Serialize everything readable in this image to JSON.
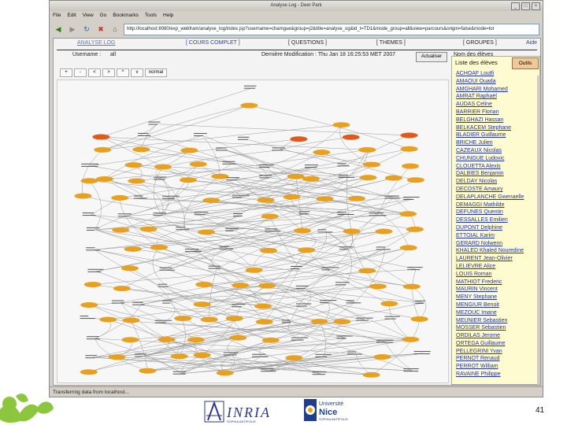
{
  "window": {
    "title": "Analyse Log - Deer Park"
  },
  "menu": [
    "File",
    "Edit",
    "View",
    "Go",
    "Bookmarks",
    "Tools",
    "Help"
  ],
  "url": "http://localhost:8080/exp_webfram/analyse_log/index.jsp?username=chamgue&group=j2&title=analyse_og&id_t=TD1&mode_group=all&view=parcours&origin=false&mode=tor",
  "tabs": {
    "analyse_log": "ANALYSE LOG",
    "cours_complet": "[ COURS COMPLET ]",
    "questions": "[ QUESTIONS ]",
    "themes": "[ THEMES ]",
    "groupes": "[ GROUPES ]",
    "aide": "Aide"
  },
  "info": {
    "username_label": "Username :",
    "username_value": "all",
    "modif": "Dernière Modification : Thu Jan 18 16:25:53 MET 2007",
    "refresh": "Actualiser",
    "students_header": "Nom des élèves"
  },
  "zoom": [
    "+",
    "-",
    "<",
    ">",
    "^",
    "v",
    "normal"
  ],
  "students": {
    "title": "Liste des élèves",
    "tools": "Outils",
    "names": [
      "ACHOAF Loutfi",
      "AMAOUI Ouada",
      "AMGHARI Mohamed",
      "AMRAT Raphaël",
      "AUDAS Celine",
      "BARRIER Florian",
      "BELGHAZI Hassan",
      "BELKACEM Stephane",
      "BLADIER Guillaume",
      "BRICHE Julien",
      "CAZEAUX Nicolas",
      "CHUNGUE Ludovic",
      "CLOUETTA Alexis",
      "DALBIES Benjamin",
      "DELDAY Nicolas",
      "DECOSTE Amaury",
      "DELAPLANCHE Gwenaelle",
      "DEMAGGI Mathilde",
      "DEFUNES Quentin",
      "DESSALLES Emilien",
      "DUPONT Delphine",
      "ETTOIAL Karim",
      "GERARD Nolwenn",
      "KHALED Khaled Nouredine",
      "LAURENT Jean-Olivier",
      "LELIEVRE Alice",
      "LOUIS Roman",
      "MATHIOT Frederic",
      "MAURIN Vincent",
      "MENY Stephane",
      "MENGIUR Benoit",
      "MEZOUC Imane",
      "MEUNIER Sebastien",
      "MOSSER Sebastien",
      "ORDILAS Jerome",
      "ORTEGA Guillaume",
      "PELLEGRINI Yvan",
      "PERNOT Renaud",
      "PERROT William",
      "RAVAINE Philippe"
    ]
  },
  "status": "Transferring data from localhost...",
  "footer": {
    "page_number": "41",
    "inria": "INRIA",
    "univ": "Université Nice Sophia Antipolis"
  },
  "colors": {
    "node": "#e8a020",
    "node_red": "#e05a1a",
    "link": "#2233b0",
    "panel": "#fefbd0"
  }
}
